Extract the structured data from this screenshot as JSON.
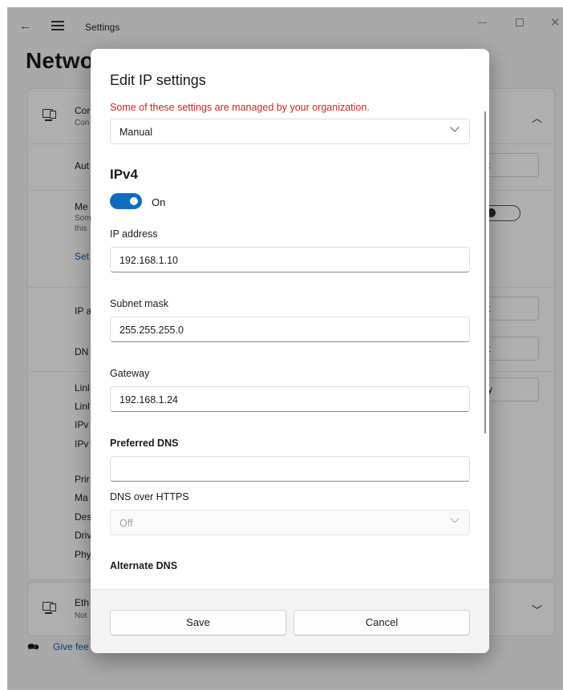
{
  "window": {
    "title": "Settings",
    "page_title_visible": "Netwo"
  },
  "background": {
    "adapter_row": {
      "title": "Cor",
      "subtitle": "Con"
    },
    "auto_label": "Aut",
    "metered": {
      "title": "Me",
      "line1": "Som",
      "line2": "this"
    },
    "set_link": "Set",
    "ip_label": "IP a",
    "dns_label": "DN",
    "props": [
      "Linl",
      "Linl",
      "IPv",
      "IPv",
      "Prir",
      "Ma",
      "Des",
      "Driv",
      "Phy"
    ],
    "btn_edit_text": "t",
    "btn_copy_text": "y",
    "ethernet": {
      "title": "Eth",
      "subtitle": "Not"
    },
    "feedback": "Give fee"
  },
  "dialog": {
    "title": "Edit IP settings",
    "warning": "Some of these settings are managed by your organization.",
    "mode": "Manual",
    "section": "IPv4",
    "toggle_label": "On",
    "ip_label": "IP address",
    "ip_value": "192.168.1.10",
    "subnet_label": "Subnet mask",
    "subnet_value": "255.255.255.0",
    "gateway_label": "Gateway",
    "gateway_value": "192.168.1.24",
    "pref_dns_label": "Preferred DNS",
    "pref_dns_value": "",
    "doh_label": "DNS over HTTPS",
    "doh_value": "Off",
    "alt_dns_label": "Alternate DNS",
    "save": "Save",
    "cancel": "Cancel"
  },
  "colors": {
    "accent": "#0f6cbd",
    "warning": "#c42b1c"
  }
}
